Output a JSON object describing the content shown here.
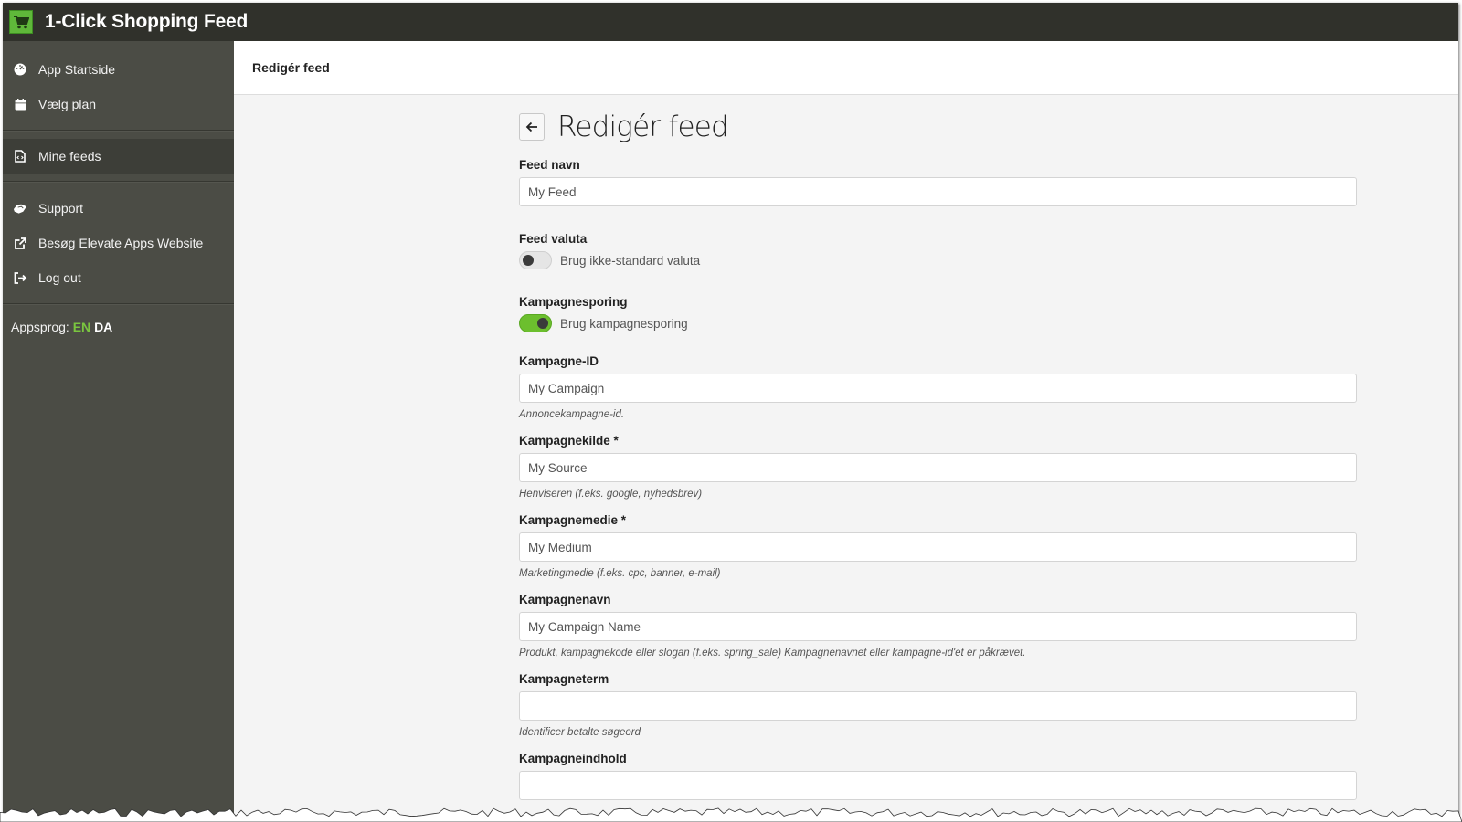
{
  "app": {
    "title": "1-Click Shopping Feed",
    "logo_icon": "shopping-cart-icon",
    "brand_color": "#5fb83a"
  },
  "sidebar": {
    "items": [
      {
        "label": "App Startside",
        "icon": "dashboard-icon",
        "active": false
      },
      {
        "label": "Vælg plan",
        "icon": "calendar-icon",
        "active": false
      },
      {
        "label": "Mine feeds",
        "icon": "file-code-icon",
        "active": true
      },
      {
        "label": "Support",
        "icon": "handshake-icon",
        "active": false
      },
      {
        "label": "Besøg Elevate Apps Website",
        "icon": "external-link-icon",
        "active": false
      },
      {
        "label": "Log out",
        "icon": "sign-out-icon",
        "active": false
      }
    ],
    "language": {
      "label": "Appsprog:",
      "options": [
        "EN",
        "DA"
      ],
      "highlight_color": "#7ac53f"
    }
  },
  "header": {
    "title": "Redigér feed"
  },
  "page": {
    "title": "Redigér feed",
    "back_icon": "arrow-left-icon"
  },
  "form": {
    "feed_name": {
      "label": "Feed navn",
      "value": "My Feed"
    },
    "feed_currency": {
      "label": "Feed valuta",
      "toggle_label": "Brug ikke-standard valuta",
      "enabled": false
    },
    "campaign_tracking": {
      "label": "Kampagnesporing",
      "toggle_label": "Brug kampagnesporing",
      "enabled": true
    },
    "campaign_id": {
      "label": "Kampagne-ID",
      "value": "My Campaign",
      "help": "Annoncekampagne-id."
    },
    "campaign_source": {
      "label": "Kampagnekilde *",
      "value": "My Source",
      "help": "Henviseren (f.eks. google, nyhedsbrev)"
    },
    "campaign_medium": {
      "label": "Kampagnemedie *",
      "value": "My Medium",
      "help": "Marketingmedie (f.eks. cpc, banner, e-mail)"
    },
    "campaign_name": {
      "label": "Kampagnenavn",
      "value": "My Campaign Name",
      "help": "Produkt, kampagnekode eller slogan (f.eks. spring_sale) Kampagnenavnet eller kampagne-id'et er påkrævet."
    },
    "campaign_term": {
      "label": "Kampagneterm",
      "value": "",
      "help": "Identificer betalte søgeord"
    },
    "campaign_content": {
      "label": "Kampagneindhold",
      "value": ""
    }
  }
}
